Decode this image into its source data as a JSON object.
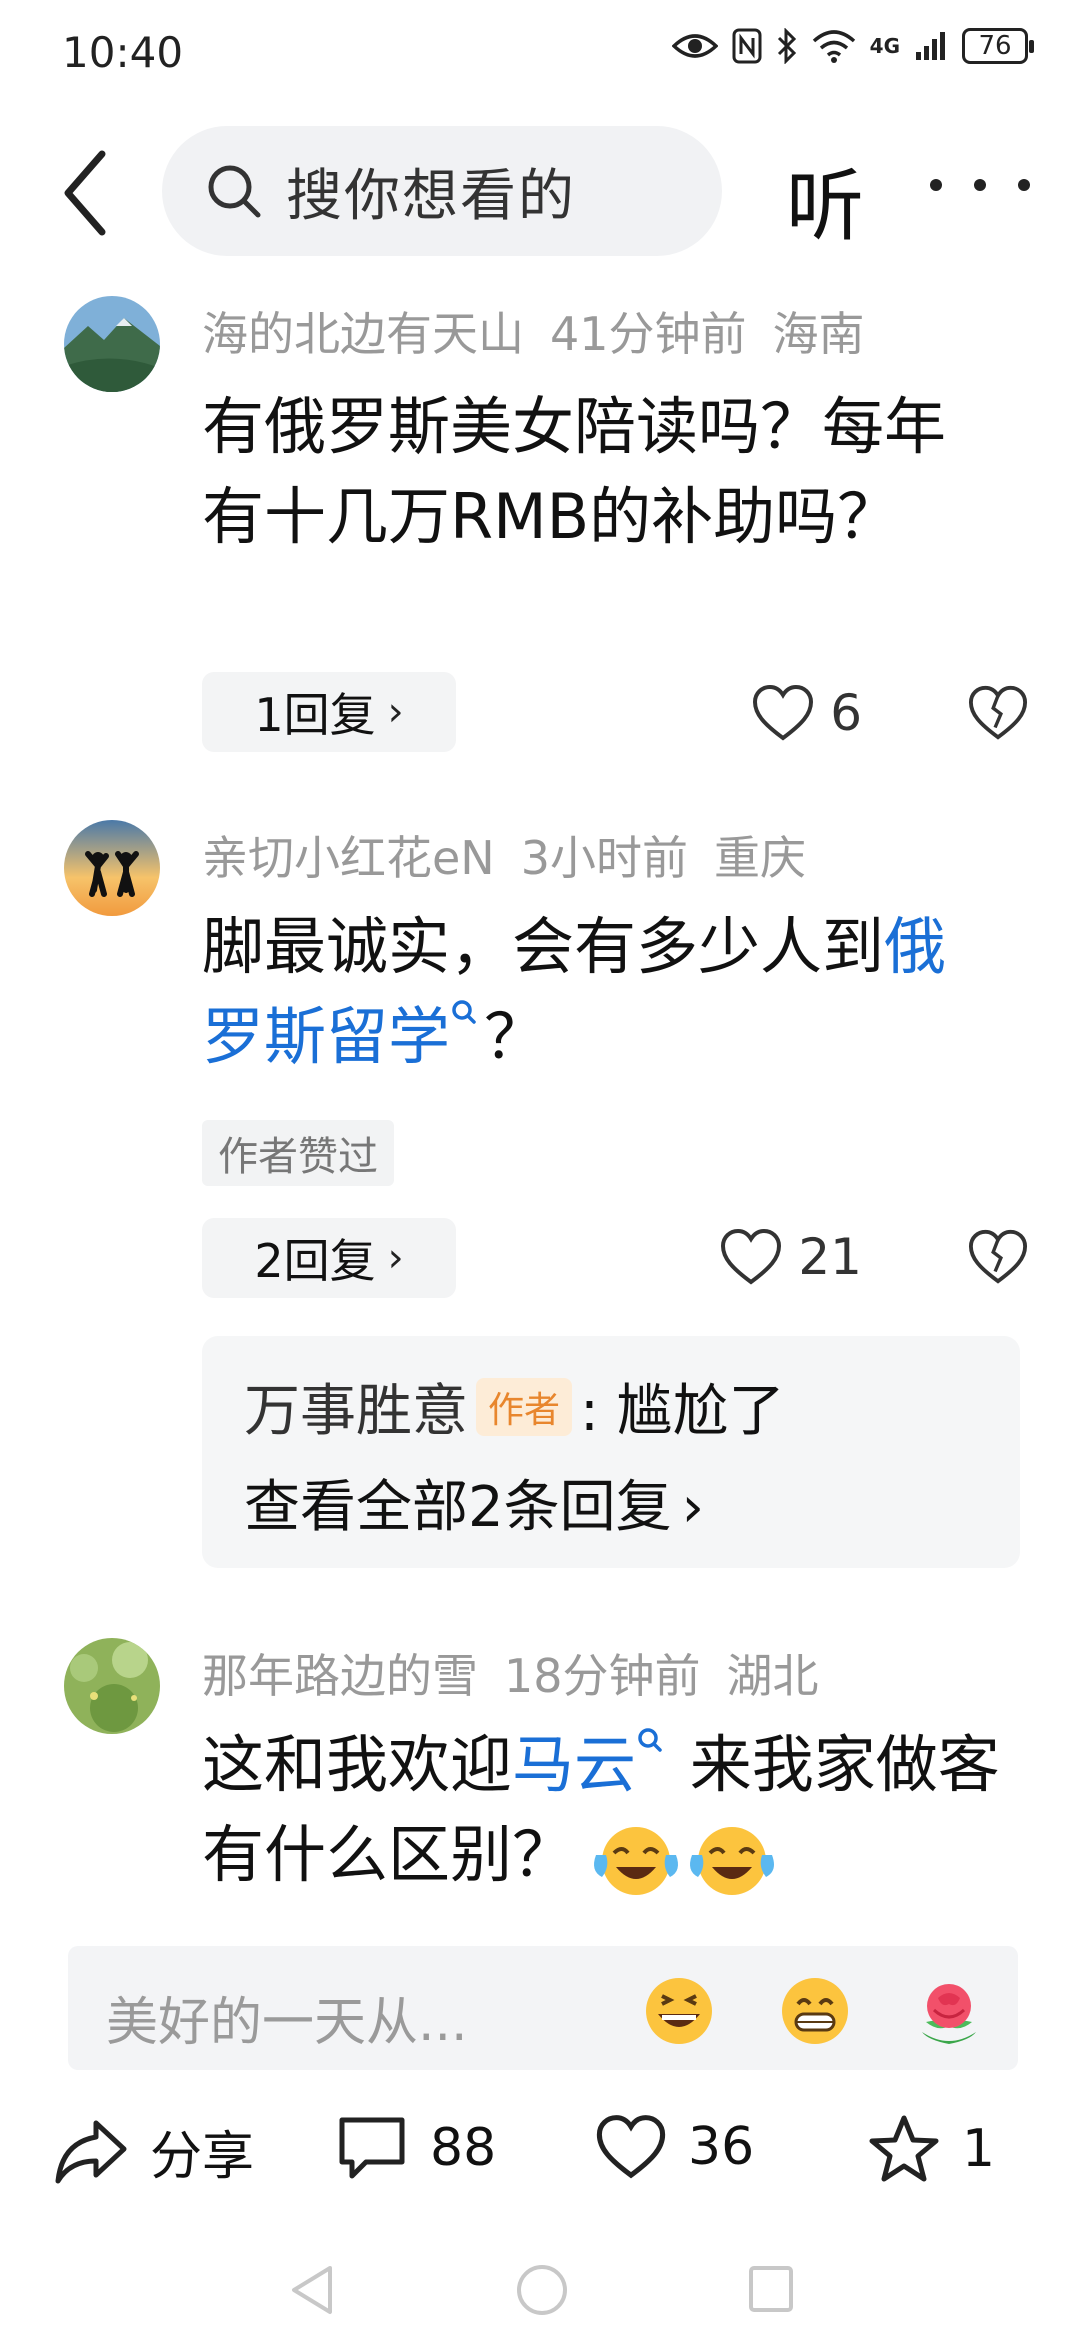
{
  "status_bar": {
    "time": "10:40",
    "network": "4G",
    "battery": "76"
  },
  "nav": {
    "search_placeholder": "搜你想看的",
    "listen_label": "听"
  },
  "comments": [
    {
      "user": "海的北边有天山",
      "time": "41分钟前",
      "location": "海南",
      "text": "有俄罗斯美女陪读吗？每年有十几万RMB的补助吗？",
      "replies_label": "1回复",
      "likes": "6"
    },
    {
      "user": "亲切小红花eN",
      "time": "3小时前",
      "location": "重庆",
      "text_before": "脚最诚实，会有多少人到",
      "link_text": "俄罗斯留学",
      "text_after": "？",
      "author_liked": "作者赞过",
      "replies_label": "2回复",
      "likes": "21",
      "sub_reply": {
        "author": "万事胜意",
        "author_tag": "作者",
        "text": ": 尴尬了",
        "view_all": "查看全部2条回复"
      }
    },
    {
      "user": "那年路边的雪",
      "time": "18分钟前",
      "location": "湖北",
      "text_before": "这和我欢迎",
      "link_text": "马云",
      "text_after": " 来我家做客有什么区别？"
    }
  ],
  "input": {
    "placeholder": "美好的一天从..."
  },
  "actions": {
    "share_label": "分享",
    "comments_count": "88",
    "likes_count": "36",
    "favorites_count": "1"
  },
  "colors": {
    "link": "#1a6fd6",
    "author_tag_bg": "#fdecd7",
    "author_tag_text": "#e8862d"
  }
}
